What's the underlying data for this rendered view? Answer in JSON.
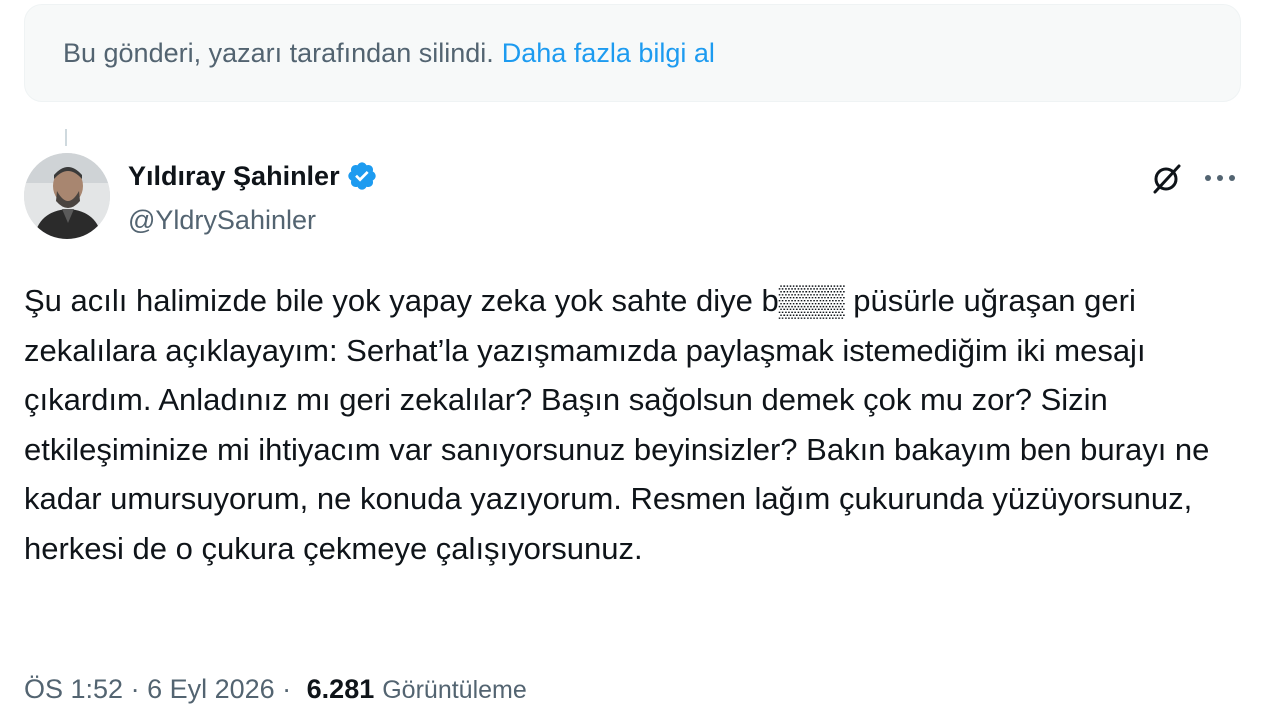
{
  "notice": {
    "text": "Bu gönderi, yazarı tarafından silindi.",
    "link": "Daha fazla bilgi al"
  },
  "author": {
    "display_name": "Yıldıray Şahinler",
    "handle": "@YldrySahinler",
    "verified": true,
    "avatar_icon": "profile-photo"
  },
  "actions": {
    "grok_icon": "grok-icon",
    "more_icon": "more-dots-icon"
  },
  "tweet": {
    "text": "Şu acılı halimizde bile yok yapay zeka yok sahte diye b▒▒▒ püsürle uğraşan geri zekalılara açıklayayım: Serhat’la yazışmamızda paylaşmak istemediğim iki mesajı çıkardım. Anladınız mı geri zekalılar? Başın sağolsun demek çok mu zor? Sizin etkileşiminize mi ihtiyacım var sanıyorsunuz beyinsizler? Bakın bakayım ben burayı ne kadar umursuyorum, ne konuda yazıyorum. Resmen lağım çukurunda yüzüyorsunuz, herkesi de o çukura çekmeye çalışıyorsunuz."
  },
  "meta": {
    "time": "ÖS 1:52",
    "separator": " · ",
    "date": "6 Eyl 2026",
    "views_count": "6.281",
    "views_label": "Görüntüleme"
  },
  "colors": {
    "accent": "#1d9bf0",
    "secondary_text": "#536471",
    "notice_bg": "#f7f9f9"
  }
}
